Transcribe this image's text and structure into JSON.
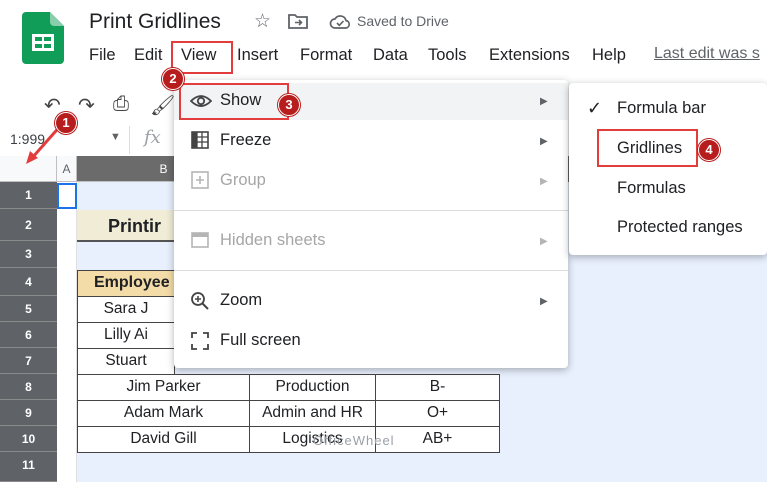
{
  "header": {
    "doc_title": "Print Gridlines",
    "saved_status": "Saved to Drive",
    "last_edit": "Last edit was s"
  },
  "menubar": {
    "items": [
      "File",
      "Edit",
      "View",
      "Insert",
      "Format",
      "Data",
      "Tools",
      "Extensions",
      "Help"
    ]
  },
  "namebox": {
    "value": "1:999"
  },
  "formula": {
    "fx": "fx"
  },
  "columns": {
    "a": "A",
    "b": "B"
  },
  "rows": [
    "1",
    "2",
    "3",
    "4",
    "5",
    "6",
    "7",
    "8",
    "9",
    "10",
    "11"
  ],
  "sheet": {
    "title": "Printir",
    "header": "Employee",
    "names": [
      "Sara J",
      "Lilly Ai",
      "Stuart"
    ],
    "full_rows": [
      {
        "name": "Jim Parker",
        "dept": "Production",
        "blood": "B-"
      },
      {
        "name": "Adam Mark",
        "dept": "Admin and HR",
        "blood": "O+"
      },
      {
        "name": "David Gill",
        "dept": "Logistics",
        "blood": "AB+"
      }
    ]
  },
  "view_menu": {
    "show": "Show",
    "freeze": "Freeze",
    "group": "Group",
    "hidden_sheets": "Hidden sheets",
    "zoom": "Zoom",
    "full_screen": "Full screen"
  },
  "show_submenu": {
    "formula_bar": "Formula bar",
    "gridlines": "Gridlines",
    "formulas": "Formulas",
    "protected_ranges": "Protected ranges"
  },
  "annotations": [
    "1",
    "2",
    "3",
    "4"
  ],
  "watermark": "OfficeWheel",
  "colors": {
    "accent_red": "#e23c3c",
    "badge_red": "#b81d1d",
    "header_fill": "#f3dca7",
    "selection_blue": "#1a73e8",
    "sheets_green": "#0f9d58"
  }
}
